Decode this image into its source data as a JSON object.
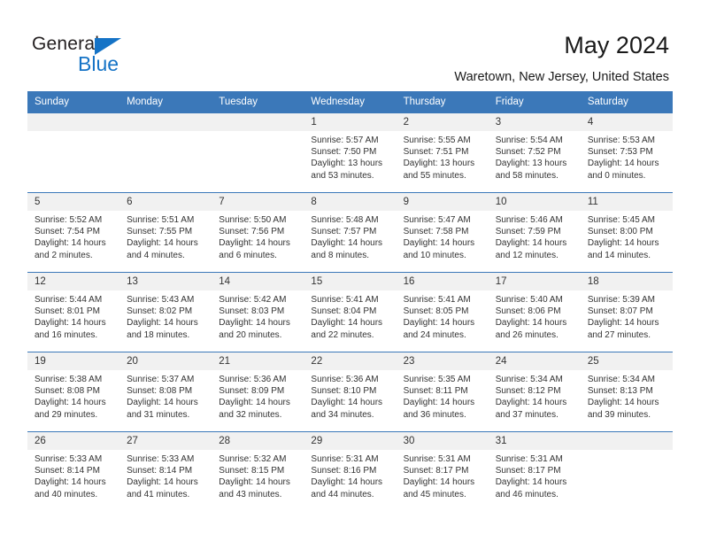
{
  "brand": {
    "name_dark": "General",
    "name_blue": "Blue",
    "color_blue": "#1573c6",
    "triangle_icon": "triangle-right-icon"
  },
  "header": {
    "title": "May 2024",
    "subtitle": "Waretown, New Jersey, United States",
    "header_bg": "#3b78b9",
    "daynum_bg": "#f1f1f1"
  },
  "calendar": {
    "weekday_headers": [
      "Sunday",
      "Monday",
      "Tuesday",
      "Wednesday",
      "Thursday",
      "Friday",
      "Saturday"
    ],
    "labels": {
      "sunrise": "Sunrise:",
      "sunset": "Sunset:",
      "daylight": "Daylight:"
    },
    "weeks": [
      [
        {
          "day": "",
          "sunrise": "",
          "sunset": "",
          "daylight_line1": "",
          "daylight_line2": "",
          "blank": true
        },
        {
          "day": "",
          "sunrise": "",
          "sunset": "",
          "daylight_line1": "",
          "daylight_line2": "",
          "blank": true
        },
        {
          "day": "",
          "sunrise": "",
          "sunset": "",
          "daylight_line1": "",
          "daylight_line2": "",
          "blank": true
        },
        {
          "day": "1",
          "sunrise": "Sunrise: 5:57 AM",
          "sunset": "Sunset: 7:50 PM",
          "daylight_line1": "Daylight: 13 hours",
          "daylight_line2": "and 53 minutes.",
          "blank": false
        },
        {
          "day": "2",
          "sunrise": "Sunrise: 5:55 AM",
          "sunset": "Sunset: 7:51 PM",
          "daylight_line1": "Daylight: 13 hours",
          "daylight_line2": "and 55 minutes.",
          "blank": false
        },
        {
          "day": "3",
          "sunrise": "Sunrise: 5:54 AM",
          "sunset": "Sunset: 7:52 PM",
          "daylight_line1": "Daylight: 13 hours",
          "daylight_line2": "and 58 minutes.",
          "blank": false
        },
        {
          "day": "4",
          "sunrise": "Sunrise: 5:53 AM",
          "sunset": "Sunset: 7:53 PM",
          "daylight_line1": "Daylight: 14 hours",
          "daylight_line2": "and 0 minutes.",
          "blank": false
        }
      ],
      [
        {
          "day": "5",
          "sunrise": "Sunrise: 5:52 AM",
          "sunset": "Sunset: 7:54 PM",
          "daylight_line1": "Daylight: 14 hours",
          "daylight_line2": "and 2 minutes.",
          "blank": false
        },
        {
          "day": "6",
          "sunrise": "Sunrise: 5:51 AM",
          "sunset": "Sunset: 7:55 PM",
          "daylight_line1": "Daylight: 14 hours",
          "daylight_line2": "and 4 minutes.",
          "blank": false
        },
        {
          "day": "7",
          "sunrise": "Sunrise: 5:50 AM",
          "sunset": "Sunset: 7:56 PM",
          "daylight_line1": "Daylight: 14 hours",
          "daylight_line2": "and 6 minutes.",
          "blank": false
        },
        {
          "day": "8",
          "sunrise": "Sunrise: 5:48 AM",
          "sunset": "Sunset: 7:57 PM",
          "daylight_line1": "Daylight: 14 hours",
          "daylight_line2": "and 8 minutes.",
          "blank": false
        },
        {
          "day": "9",
          "sunrise": "Sunrise: 5:47 AM",
          "sunset": "Sunset: 7:58 PM",
          "daylight_line1": "Daylight: 14 hours",
          "daylight_line2": "and 10 minutes.",
          "blank": false
        },
        {
          "day": "10",
          "sunrise": "Sunrise: 5:46 AM",
          "sunset": "Sunset: 7:59 PM",
          "daylight_line1": "Daylight: 14 hours",
          "daylight_line2": "and 12 minutes.",
          "blank": false
        },
        {
          "day": "11",
          "sunrise": "Sunrise: 5:45 AM",
          "sunset": "Sunset: 8:00 PM",
          "daylight_line1": "Daylight: 14 hours",
          "daylight_line2": "and 14 minutes.",
          "blank": false
        }
      ],
      [
        {
          "day": "12",
          "sunrise": "Sunrise: 5:44 AM",
          "sunset": "Sunset: 8:01 PM",
          "daylight_line1": "Daylight: 14 hours",
          "daylight_line2": "and 16 minutes.",
          "blank": false
        },
        {
          "day": "13",
          "sunrise": "Sunrise: 5:43 AM",
          "sunset": "Sunset: 8:02 PM",
          "daylight_line1": "Daylight: 14 hours",
          "daylight_line2": "and 18 minutes.",
          "blank": false
        },
        {
          "day": "14",
          "sunrise": "Sunrise: 5:42 AM",
          "sunset": "Sunset: 8:03 PM",
          "daylight_line1": "Daylight: 14 hours",
          "daylight_line2": "and 20 minutes.",
          "blank": false
        },
        {
          "day": "15",
          "sunrise": "Sunrise: 5:41 AM",
          "sunset": "Sunset: 8:04 PM",
          "daylight_line1": "Daylight: 14 hours",
          "daylight_line2": "and 22 minutes.",
          "blank": false
        },
        {
          "day": "16",
          "sunrise": "Sunrise: 5:41 AM",
          "sunset": "Sunset: 8:05 PM",
          "daylight_line1": "Daylight: 14 hours",
          "daylight_line2": "and 24 minutes.",
          "blank": false
        },
        {
          "day": "17",
          "sunrise": "Sunrise: 5:40 AM",
          "sunset": "Sunset: 8:06 PM",
          "daylight_line1": "Daylight: 14 hours",
          "daylight_line2": "and 26 minutes.",
          "blank": false
        },
        {
          "day": "18",
          "sunrise": "Sunrise: 5:39 AM",
          "sunset": "Sunset: 8:07 PM",
          "daylight_line1": "Daylight: 14 hours",
          "daylight_line2": "and 27 minutes.",
          "blank": false
        }
      ],
      [
        {
          "day": "19",
          "sunrise": "Sunrise: 5:38 AM",
          "sunset": "Sunset: 8:08 PM",
          "daylight_line1": "Daylight: 14 hours",
          "daylight_line2": "and 29 minutes.",
          "blank": false
        },
        {
          "day": "20",
          "sunrise": "Sunrise: 5:37 AM",
          "sunset": "Sunset: 8:08 PM",
          "daylight_line1": "Daylight: 14 hours",
          "daylight_line2": "and 31 minutes.",
          "blank": false
        },
        {
          "day": "21",
          "sunrise": "Sunrise: 5:36 AM",
          "sunset": "Sunset: 8:09 PM",
          "daylight_line1": "Daylight: 14 hours",
          "daylight_line2": "and 32 minutes.",
          "blank": false
        },
        {
          "day": "22",
          "sunrise": "Sunrise: 5:36 AM",
          "sunset": "Sunset: 8:10 PM",
          "daylight_line1": "Daylight: 14 hours",
          "daylight_line2": "and 34 minutes.",
          "blank": false
        },
        {
          "day": "23",
          "sunrise": "Sunrise: 5:35 AM",
          "sunset": "Sunset: 8:11 PM",
          "daylight_line1": "Daylight: 14 hours",
          "daylight_line2": "and 36 minutes.",
          "blank": false
        },
        {
          "day": "24",
          "sunrise": "Sunrise: 5:34 AM",
          "sunset": "Sunset: 8:12 PM",
          "daylight_line1": "Daylight: 14 hours",
          "daylight_line2": "and 37 minutes.",
          "blank": false
        },
        {
          "day": "25",
          "sunrise": "Sunrise: 5:34 AM",
          "sunset": "Sunset: 8:13 PM",
          "daylight_line1": "Daylight: 14 hours",
          "daylight_line2": "and 39 minutes.",
          "blank": false
        }
      ],
      [
        {
          "day": "26",
          "sunrise": "Sunrise: 5:33 AM",
          "sunset": "Sunset: 8:14 PM",
          "daylight_line1": "Daylight: 14 hours",
          "daylight_line2": "and 40 minutes.",
          "blank": false
        },
        {
          "day": "27",
          "sunrise": "Sunrise: 5:33 AM",
          "sunset": "Sunset: 8:14 PM",
          "daylight_line1": "Daylight: 14 hours",
          "daylight_line2": "and 41 minutes.",
          "blank": false
        },
        {
          "day": "28",
          "sunrise": "Sunrise: 5:32 AM",
          "sunset": "Sunset: 8:15 PM",
          "daylight_line1": "Daylight: 14 hours",
          "daylight_line2": "and 43 minutes.",
          "blank": false
        },
        {
          "day": "29",
          "sunrise": "Sunrise: 5:31 AM",
          "sunset": "Sunset: 8:16 PM",
          "daylight_line1": "Daylight: 14 hours",
          "daylight_line2": "and 44 minutes.",
          "blank": false
        },
        {
          "day": "30",
          "sunrise": "Sunrise: 5:31 AM",
          "sunset": "Sunset: 8:17 PM",
          "daylight_line1": "Daylight: 14 hours",
          "daylight_line2": "and 45 minutes.",
          "blank": false
        },
        {
          "day": "31",
          "sunrise": "Sunrise: 5:31 AM",
          "sunset": "Sunset: 8:17 PM",
          "daylight_line1": "Daylight: 14 hours",
          "daylight_line2": "and 46 minutes.",
          "blank": false
        },
        {
          "day": "",
          "sunrise": "",
          "sunset": "",
          "daylight_line1": "",
          "daylight_line2": "",
          "blank": true
        }
      ]
    ]
  }
}
